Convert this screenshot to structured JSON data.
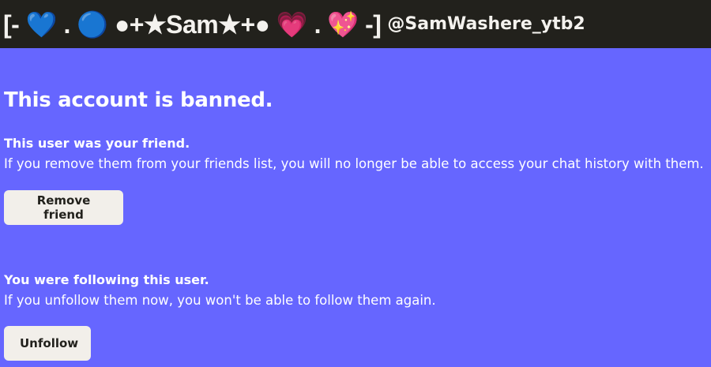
{
  "header": {
    "display_name": "[- 💙 . 🔵 ●+★Sam★+● 💗 . 💖 -]",
    "username": "@SamWashere_ytb2"
  },
  "main": {
    "title": "This account is banned.",
    "friend_section": {
      "heading": "This user was your friend.",
      "text": "If you remove them from your friends list, you will no longer be able to access your chat history with them.",
      "button_label": "Remove friend"
    },
    "follow_section": {
      "heading": "You were following this user.",
      "text": "If you unfollow them now, you won't be able to follow them again.",
      "button_label": "Unfollow"
    }
  },
  "colors": {
    "page_background": "#6666ff",
    "header_background": "#22211c",
    "button_background": "#f2efea",
    "button_text": "#22211c",
    "text": "#ffffff"
  }
}
